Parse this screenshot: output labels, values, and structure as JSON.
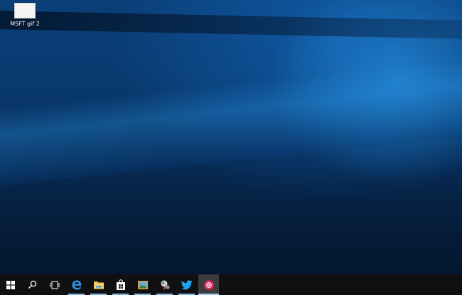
{
  "desktop": {
    "icons": [
      {
        "label": "MSFT gif 2"
      }
    ]
  },
  "taskbar": {
    "items": [
      {
        "icon": "windows-start-icon"
      },
      {
        "icon": "search-icon"
      },
      {
        "icon": "task-view-icon"
      },
      {
        "icon": "edge-browser-icon"
      },
      {
        "icon": "file-explorer-icon"
      },
      {
        "icon": "store-icon"
      },
      {
        "icon": "photos-icon"
      },
      {
        "icon": "app-icon"
      },
      {
        "icon": "twitter-icon"
      },
      {
        "icon": "app-pink-icon"
      }
    ]
  },
  "colors": {
    "taskbar": "#101010",
    "wallpaper_primary": "#0a3f78",
    "accent": "#7fb3e6",
    "twitter": "#1da1f2",
    "pink_app": "#e0245e"
  }
}
